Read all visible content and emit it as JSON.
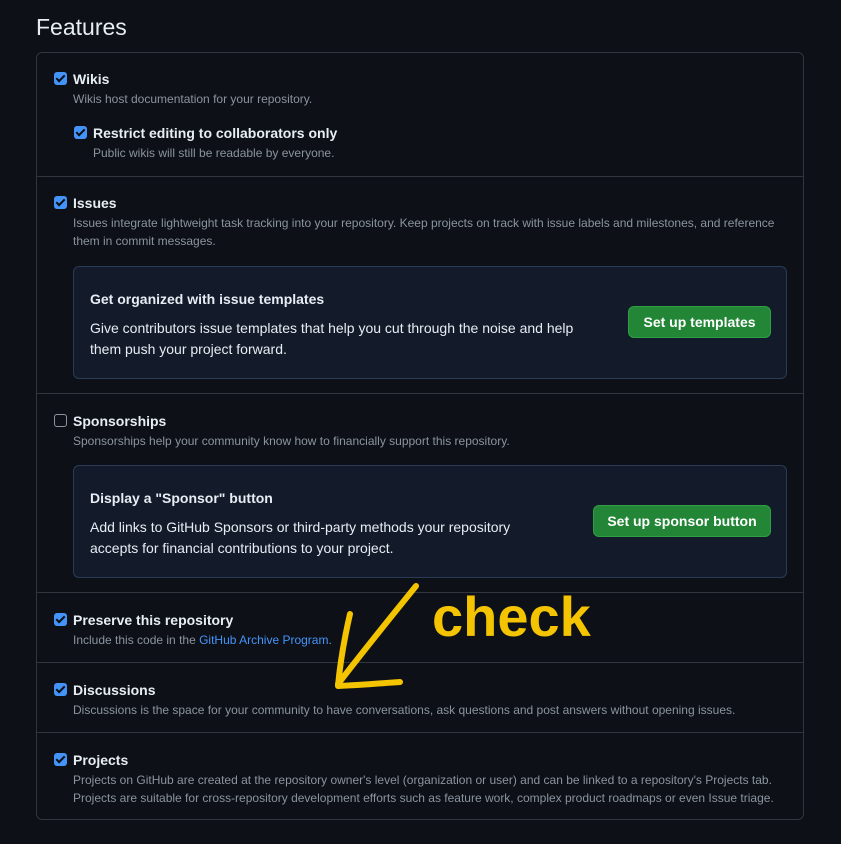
{
  "page": {
    "title": "Features"
  },
  "features": {
    "wikis": {
      "label": "Wikis",
      "checked": true,
      "description": "Wikis host documentation for your repository.",
      "restrict": {
        "label": "Restrict editing to collaborators only",
        "checked": true,
        "description": "Public wikis will still be readable by everyone."
      }
    },
    "issues": {
      "label": "Issues",
      "checked": true,
      "description": "Issues integrate lightweight task tracking into your repository. Keep projects on track with issue labels and milestones, and reference them in commit messages.",
      "callout": {
        "title": "Get organized with issue templates",
        "text": "Give contributors issue templates that help you cut through the noise and help them push your project forward.",
        "button": "Set up templates"
      }
    },
    "sponsorships": {
      "label": "Sponsorships",
      "checked": false,
      "description": "Sponsorships help your community know how to financially support this repository.",
      "callout": {
        "title": "Display a \"Sponsor\" button",
        "text": "Add links to GitHub Sponsors or third-party methods your repository accepts for financial contributions to your project.",
        "button": "Set up sponsor button"
      }
    },
    "preserve": {
      "label": "Preserve this repository",
      "checked": true,
      "description_prefix": "Include this code in the ",
      "link": "GitHub Archive Program",
      "description_suffix": "."
    },
    "discussions": {
      "label": "Discussions",
      "checked": true,
      "description": "Discussions is the space for your community to have conversations, ask questions and post answers without opening issues."
    },
    "projects": {
      "label": "Projects",
      "checked": true,
      "description": "Projects on GitHub are created at the repository owner's level (organization or user) and can be linked to a repository's Projects tab. Projects are suitable for cross-repository development efforts such as feature work, complex product roadmaps or even Issue triage."
    }
  },
  "annotation": {
    "text": "check",
    "color": "#f5c400"
  }
}
